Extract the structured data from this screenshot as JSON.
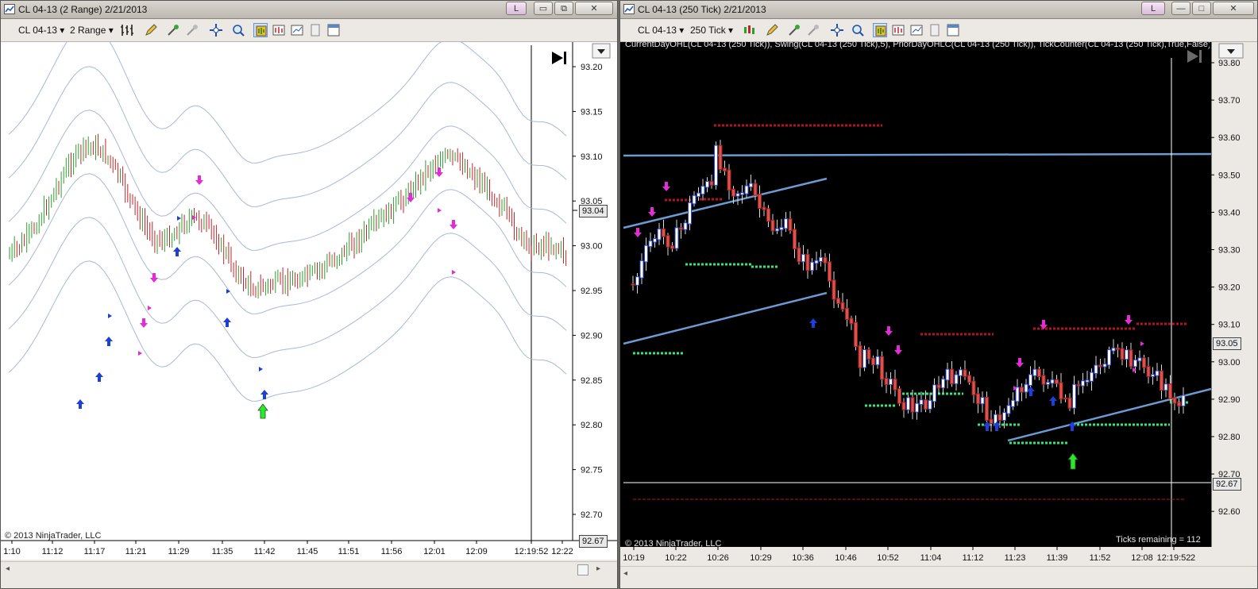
{
  "left": {
    "window_title": "CL 04-13 (2 Range)  2/21/2013",
    "toolbar": {
      "instrument": "CL 04-13",
      "period": "2 Range"
    },
    "title_buttons": {
      "link": "L",
      "minimize": "▭",
      "maximize": "⧉",
      "close": "✕"
    },
    "y_ticks": [
      "93.20",
      "93.15",
      "93.10",
      "93.05",
      "93.00",
      "92.95",
      "92.90",
      "92.85",
      "92.80",
      "92.75",
      "92.70"
    ],
    "x_ticks": [
      "1:10",
      "11:12",
      "11:17",
      "11:21",
      "11:29",
      "11:35",
      "11:42",
      "11:45",
      "11:51",
      "11:56",
      "12:01",
      "12:09",
      "12:19:52",
      "12:22"
    ],
    "last_price_tag": "93.04",
    "low_price_tag": "92.67",
    "copyright": "© 2013 NinjaTrader, LLC",
    "jump_icon": "jump-to-end-icon"
  },
  "right": {
    "window_title": "CL 04-13 (250 Tick)  2/21/2013",
    "toolbar": {
      "instrument": "CL 04-13",
      "period": "250 Tick"
    },
    "title_buttons": {
      "link": "L",
      "minimize": "—",
      "maximize": "□",
      "close": "✕"
    },
    "indicator_label": "CurrentDayOHL(CL 04-13 (250 Tick)), Swing(CL 04-13 (250 Tick),5), PriorDayOHLC(CL 04-13 (250 Tick)), TickCounter(CL 04-13 (250 Tick),True,False)",
    "y_ticks": [
      "93.80",
      "93.70",
      "93.60",
      "93.50",
      "93.40",
      "93.30",
      "93.20",
      "93.10",
      "93.00",
      "92.90",
      "92.80",
      "92.70",
      "92.60"
    ],
    "x_ticks": [
      "10:19",
      "10:22",
      "10:26",
      "10:29",
      "10:36",
      "10:46",
      "10:52",
      "11:04",
      "11:12",
      "11:23",
      "11:39",
      "11:52",
      "12:08",
      "12:19:52"
    ],
    "last_price_tag": "93.05",
    "low_price_tag": "92.67",
    "ticks_remaining": "Ticks remaining = 112",
    "copyright": "© 2013 NinjaTrader, LLC",
    "x_tail": "2"
  },
  "colors": {
    "left_bg": "#ffffff",
    "right_bg": "#000000",
    "up_bar": "#2e9e2e",
    "down_bar": "#c0262b",
    "band": "#a8b8d6",
    "magenta": "#e52bd6",
    "blue_arrow": "#1d3fd8",
    "green_arrow": "#2ee62e",
    "swing_high": "#b3141f",
    "swing_low": "#2ee87a",
    "trend_line": "#6d9ad0"
  }
}
